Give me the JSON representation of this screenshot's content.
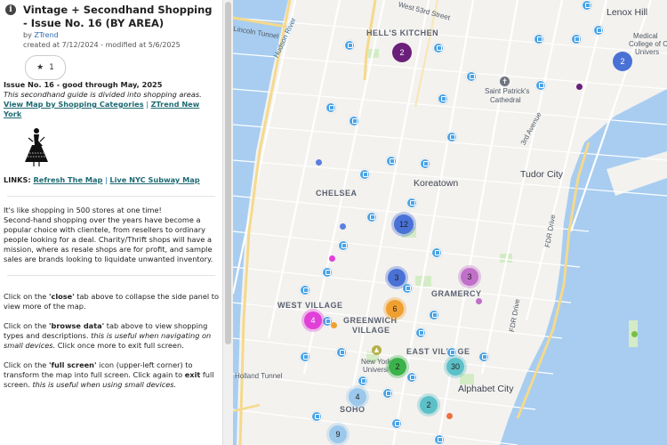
{
  "panel": {
    "title": "Vintage + Secondhand Shopping - Issue No. 16 (BY AREA)",
    "by_prefix": "by ",
    "author": "ZTrend",
    "created": "created at 7/12/2024 - modified at 5/6/2025",
    "favorites_count": "1",
    "issue_heading": "Issue No. 16 - good through May, 2025",
    "intro_italic": "This secondhand guide is divided into shopping areas.",
    "link_categories": "View Map by Shopping Categories",
    "separator": "|",
    "link_ztrend": "ZTrend New York",
    "links_prefix": "LINKS: ",
    "link_refresh": "Refresh The Map",
    "link_subway": "Live NYC Subway Map",
    "para1_l1": "It's like shopping in 500 stores at one time!",
    "para1_rest": "Second-hand shopping over the years have become a popular choice with clientele, from resellers to ordinary people looking for a deal. Charity/Thrift shops will have a mission, where as resale shops are for profit, and sample sales are brands looking to liquidate unwanted inventory.",
    "close_a": "Click on the ",
    "close_b": "'close'",
    "close_c": " tab above to collapse the side panel to view more of the map.",
    "browse_a": "Click on the ",
    "browse_b": "'browse data'",
    "browse_c": " tab above to view shopping types and descriptions. ",
    "browse_d": "this is useful when navigating on small devices.",
    "browse_e": " Click once more to exit full screen.",
    "full_a": "Click on the ",
    "full_b": "'full screen'",
    "full_c": " icon (upper-left corner) to transform the map into full screen. Click again to ",
    "full_d": "exit",
    "full_e": " full screen. ",
    "full_f": "this is useful when using small devices."
  },
  "map": {
    "labels": {
      "hells_kitchen": "HELL'S KITCHEN",
      "w53": "West 53rd Street",
      "hudson": "Hudson River",
      "lincoln_tunnel": "Lincoln Tunnel",
      "lenox": "Lenox Hill",
      "medical_1": "Medical",
      "medical_2": "College of C",
      "medical_3": "Univers",
      "st_patrick_1": "Saint Patrick's",
      "st_patrick_2": "Cathedral",
      "third_ave": "3rd Avenue",
      "tudor": "Tudor City",
      "koreatown": "Koreatown",
      "chelsea": "CHELSEA",
      "fdr1": "FDR Drive",
      "fdr2": "FDR Drive",
      "gramercy": "GRAMERCY",
      "west_village": "WEST VILLAGE",
      "greenwich_1": "GREENWICH",
      "greenwich_2": "VILLAGE",
      "east_village": "EAST VILLAGE",
      "nyu_1": "New York",
      "nyu_2": "Universi",
      "alphabet": "Alphabet City",
      "holland": "Holland Tunnel",
      "soho": "SOHO"
    },
    "clusters": [
      "2",
      "2",
      "12",
      "3",
      "3",
      "6",
      "4",
      "2",
      "30",
      "4",
      "2",
      "9"
    ],
    "colors": {
      "water": "#a8cdf0",
      "land": "#f3f2ef",
      "park": "#d4ecc6",
      "pin": "#4aa3e6",
      "purple_cluster": "#6b1f7a",
      "blue_cluster": "#4a71d6",
      "orange_cluster": "#f0a030",
      "magenta_cluster": "#e040d8",
      "green_cluster": "#3cb24a",
      "teal_cluster": "#5cc0c8",
      "lightblue_cluster": "#9cc8ec",
      "link": "#1e6a72"
    }
  }
}
